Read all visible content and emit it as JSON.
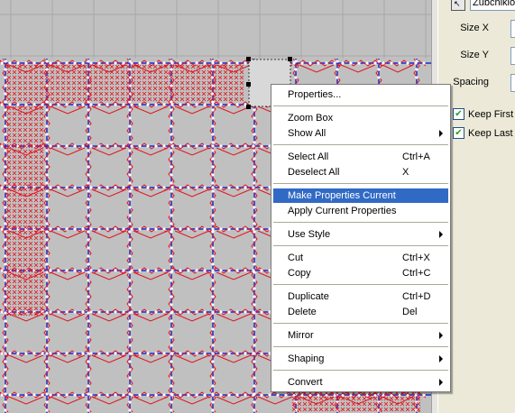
{
  "panel": {
    "top_field_value": "Zubchiklo",
    "size_x_label": "Size X",
    "size_y_label": "Size Y",
    "spacing_label": "Spacing",
    "keep_first_label": "Keep First N",
    "keep_last_label": "Keep Last I",
    "keep_first_checked": true,
    "keep_last_checked": true
  },
  "menu": {
    "properties": "Properties...",
    "zoom_box": "Zoom Box",
    "show_all": "Show All",
    "select_all": "Select All",
    "select_all_sc": "Ctrl+A",
    "deselect_all": "Deselect All",
    "deselect_all_sc": "X",
    "make_properties_current": "Make Properties Current",
    "apply_current_properties": "Apply Current Properties",
    "use_style": "Use Style",
    "cut": "Cut",
    "cut_sc": "Ctrl+X",
    "copy": "Copy",
    "copy_sc": "Ctrl+C",
    "duplicate": "Duplicate",
    "duplicate_sc": "Ctrl+D",
    "delete": "Delete",
    "delete_sc": "Del",
    "mirror": "Mirror",
    "shaping": "Shaping",
    "convert": "Convert"
  },
  "colors": {
    "highlight": "#316ac5",
    "stitch_red": "#e0141e",
    "stitch_blue": "#1a2bd0",
    "node_white": "#ffffff",
    "canvas_bg": "#c0c0c0"
  }
}
